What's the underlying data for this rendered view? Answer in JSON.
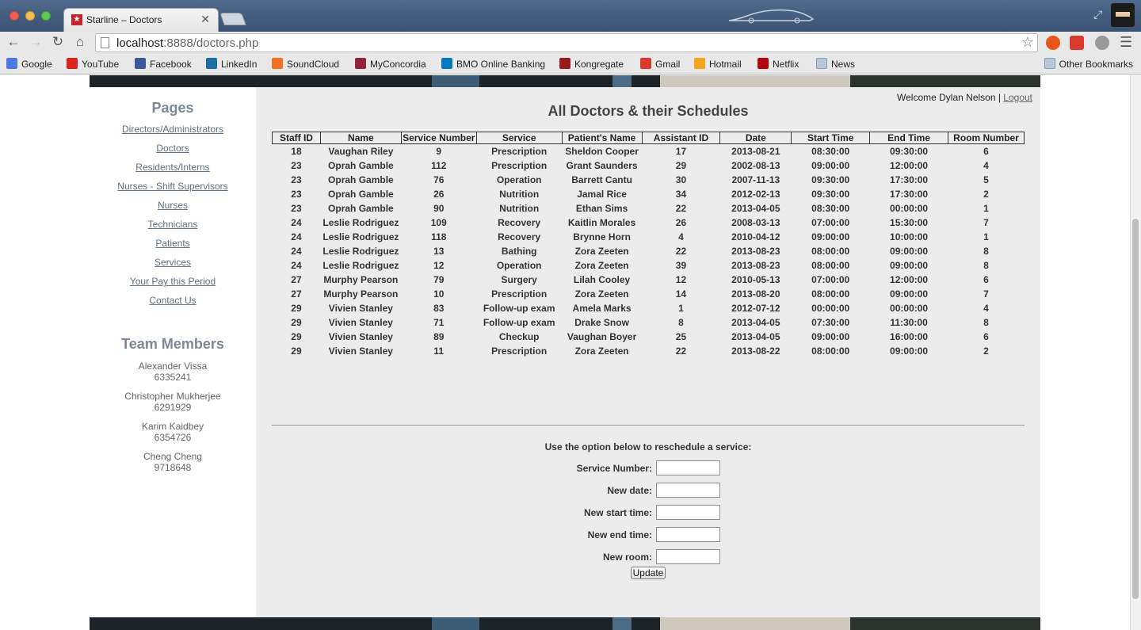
{
  "browser": {
    "tab_title": "Starline – Doctors",
    "tab_close": "✕",
    "url_host": "localhost",
    "url_rest": ":8888/doctors.php",
    "star": "☆",
    "menu": "☰",
    "back": "←",
    "forward": "→",
    "reload": "↻",
    "home": "⌂",
    "expand": "⤢",
    "bookmarks": [
      {
        "label": "Google",
        "color": "#4a7ae0"
      },
      {
        "label": "YouTube",
        "color": "#d8261f"
      },
      {
        "label": "Facebook",
        "color": "#3b5998"
      },
      {
        "label": "LinkedIn",
        "color": "#1a6fa6"
      },
      {
        "label": "SoundCloud",
        "color": "#f26f23"
      },
      {
        "label": "MyConcordia",
        "color": "#912338"
      },
      {
        "label": "BMO Online Banking",
        "color": "#0079c1"
      },
      {
        "label": "Kongregate",
        "color": "#9b1c20"
      },
      {
        "label": "Gmail",
        "color": "#d93a2b"
      },
      {
        "label": "Hotmail",
        "color": "#f3a51b"
      },
      {
        "label": "Netflix",
        "color": "#b00610"
      },
      {
        "label": "News",
        "color": "#b9c7d8"
      }
    ],
    "other_bookmarks": "Other Bookmarks"
  },
  "sidebar": {
    "pages_heading": "Pages",
    "links": [
      "Directors/Administrators",
      "Doctors",
      "Residents/Interns",
      "Nurses - Shift Supervisors",
      "Nurses",
      "Technicians",
      "Patients",
      "Services",
      "Your Pay this Period",
      "Contact Us"
    ],
    "team_heading": "Team Members",
    "members": [
      {
        "name": "Alexander Vissa",
        "id": "6335241"
      },
      {
        "name": "Christopher Mukherjee",
        "id": "6291929"
      },
      {
        "name": "Karim Kaidbey",
        "id": "6354726"
      },
      {
        "name": "Cheng Cheng",
        "id": "9718648"
      }
    ]
  },
  "header": {
    "welcome": "Welcome Dylan Nelson | ",
    "logout": "Logout",
    "title": "All Doctors & their Schedules"
  },
  "table": {
    "columns": [
      "Staff ID",
      "Name",
      "Service Number",
      "Service",
      "Patient's Name",
      "Assistant ID",
      "Date",
      "Start Time",
      "End Time",
      "Room Number"
    ],
    "rows": [
      [
        "18",
        "Vaughan Riley",
        "9",
        "Prescription",
        "Sheldon Cooper",
        "17",
        "2013-08-21",
        "08:30:00",
        "09:30:00",
        "6"
      ],
      [
        "23",
        "Oprah Gamble",
        "112",
        "Prescription",
        "Grant Saunders",
        "29",
        "2002-08-13",
        "09:00:00",
        "12:00:00",
        "4"
      ],
      [
        "23",
        "Oprah Gamble",
        "76",
        "Operation",
        "Barrett Cantu",
        "30",
        "2007-11-13",
        "09:30:00",
        "17:30:00",
        "5"
      ],
      [
        "23",
        "Oprah Gamble",
        "26",
        "Nutrition",
        "Jamal Rice",
        "34",
        "2012-02-13",
        "09:30:00",
        "17:30:00",
        "2"
      ],
      [
        "23",
        "Oprah Gamble",
        "90",
        "Nutrition",
        "Ethan Sims",
        "22",
        "2013-04-05",
        "08:30:00",
        "00:00:00",
        "1"
      ],
      [
        "24",
        "Leslie Rodriguez",
        "109",
        "Recovery",
        "Kaitlin Morales",
        "26",
        "2008-03-13",
        "07:00:00",
        "15:30:00",
        "7"
      ],
      [
        "24",
        "Leslie Rodriguez",
        "118",
        "Recovery",
        "Brynne Horn",
        "4",
        "2010-04-12",
        "09:00:00",
        "10:00:00",
        "1"
      ],
      [
        "24",
        "Leslie Rodriguez",
        "13",
        "Bathing",
        "Zora Zeeten",
        "22",
        "2013-08-23",
        "08:00:00",
        "09:00:00",
        "8"
      ],
      [
        "24",
        "Leslie Rodriguez",
        "12",
        "Operation",
        "Zora Zeeten",
        "39",
        "2013-08-23",
        "08:00:00",
        "09:00:00",
        "8"
      ],
      [
        "27",
        "Murphy Pearson",
        "79",
        "Surgery",
        "Lilah Cooley",
        "12",
        "2010-05-13",
        "07:00:00",
        "12:00:00",
        "6"
      ],
      [
        "27",
        "Murphy Pearson",
        "10",
        "Prescription",
        "Zora Zeeten",
        "14",
        "2013-08-20",
        "08:00:00",
        "09:00:00",
        "7"
      ],
      [
        "29",
        "Vivien Stanley",
        "83",
        "Follow-up exam",
        "Amela Marks",
        "1",
        "2012-07-12",
        "00:00:00",
        "00:00:00",
        "4"
      ],
      [
        "29",
        "Vivien Stanley",
        "71",
        "Follow-up exam",
        "Drake Snow",
        "8",
        "2013-04-05",
        "07:30:00",
        "11:30:00",
        "8"
      ],
      [
        "29",
        "Vivien Stanley",
        "89",
        "Checkup",
        "Vaughan Boyer",
        "25",
        "2013-04-05",
        "09:00:00",
        "16:00:00",
        "6"
      ],
      [
        "29",
        "Vivien Stanley",
        "11",
        "Prescription",
        "Zora Zeeten",
        "22",
        "2013-08-22",
        "08:00:00",
        "09:00:00",
        "2"
      ]
    ]
  },
  "form": {
    "intro": "Use the option below to reschedule a service:",
    "fields": [
      {
        "label": "Service Number:",
        "value": ""
      },
      {
        "label": "New date:",
        "value": ""
      },
      {
        "label": "New start time:",
        "value": ""
      },
      {
        "label": "New end time:",
        "value": ""
      },
      {
        "label": "New room:",
        "value": ""
      }
    ],
    "submit": "Update"
  }
}
